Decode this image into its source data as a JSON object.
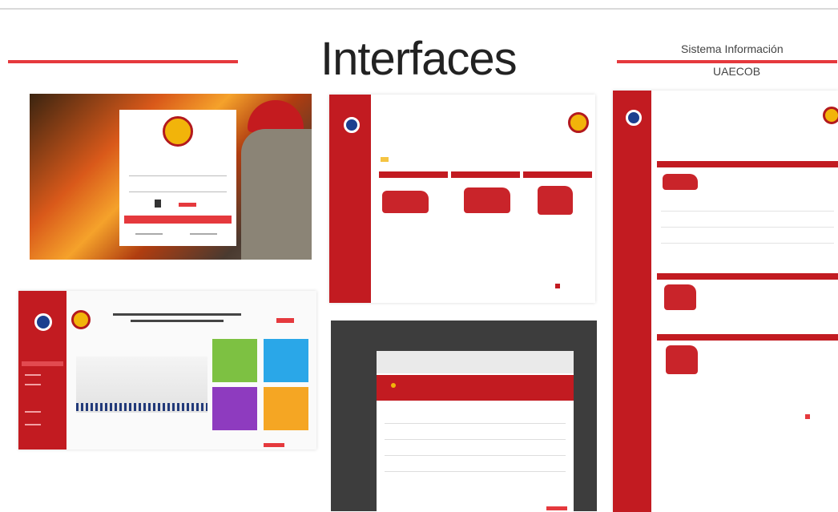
{
  "header": {
    "title": "Interfaces",
    "subtitle_line1": "Sistema Información",
    "subtitle_line2": "UAECOB"
  },
  "colors": {
    "accent": "#e5393d",
    "sidebar": "#c21b21",
    "tile_green": "#7dc142",
    "tile_blue": "#2aa7e8",
    "tile_purple": "#8e3bbf",
    "tile_orange": "#f5a623"
  }
}
